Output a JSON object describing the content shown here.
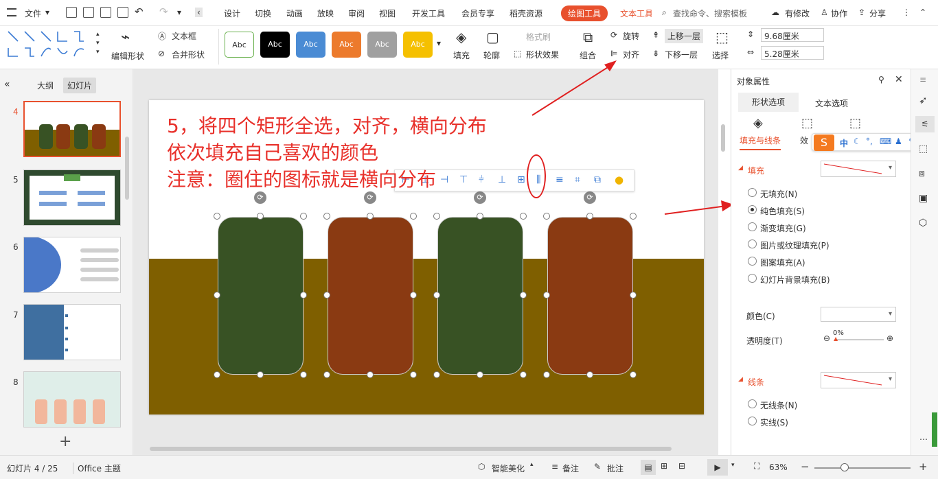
{
  "menubar": {
    "file": "文件",
    "tabs": [
      "设计",
      "切换",
      "动画",
      "放映",
      "审阅",
      "视图",
      "开发工具",
      "会员专享",
      "稻壳资源"
    ],
    "drawing_tools": "绘图工具",
    "text_tools": "文本工具",
    "search_placeholder": "查找命令、搜索模板",
    "modified": "有修改",
    "collaborate": "协作",
    "share": "分享"
  },
  "ribbon": {
    "edit_shape": "编辑形状",
    "text_box": "文本框",
    "merge_shape": "合并形状",
    "style_label": "Abc",
    "fill": "填充",
    "outline": "轮廓",
    "format_painter": "格式刷",
    "shape_effect": "形状效果",
    "group": "组合",
    "rotate": "旋转",
    "align": "对齐",
    "bring_forward": "上移一层",
    "send_backward": "下移一层",
    "select": "选择",
    "height": "9.68厘米",
    "width": "5.28厘米",
    "style_colors": [
      "#ffffff",
      "#000000",
      "#4a8bd4",
      "#ec7a2c",
      "#a0a0a0",
      "#f5c000"
    ]
  },
  "left_panel": {
    "tab_outline": "大纲",
    "tab_slides": "幻灯片",
    "slide_numbers": [
      "4",
      "5",
      "6",
      "7",
      "8"
    ]
  },
  "slide": {
    "instruction_lines": [
      "5，将四个矩形全选，对齐，横向分布",
      "依次填充自己喜欢的颜色",
      "注意：圈住的图标就是横向分布"
    ],
    "rect_colors": [
      "#385224",
      "#8a3a12",
      "#385224",
      "#8a3a12"
    ],
    "band_color": "#7f5f00"
  },
  "right_panel": {
    "title": "对象属性",
    "tab_shape": "形状选项",
    "tab_text": "文本选项",
    "subtab_fill_line": "填充与线条",
    "subtab_effect": "效",
    "section_fill": "填充",
    "fill_options": [
      "无填充(N)",
      "纯色填充(S)",
      "渐变填充(G)",
      "图片或纹理填充(P)",
      "图案填充(A)",
      "幻灯片背景填充(B)"
    ],
    "selected_fill": 1,
    "color_label": "颜色(C)",
    "transparency_label": "透明度(T)",
    "transparency_value": "0%",
    "section_line": "线条",
    "line_options": [
      "无线条(N)",
      "实线(S)"
    ]
  },
  "ime": {
    "mode": "中"
  },
  "status": {
    "slide_info": "幻灯片 4 / 25",
    "theme": "Office 主题",
    "smart_beautify": "智能美化",
    "notes": "备注",
    "comments": "批注",
    "zoom": "63%"
  }
}
